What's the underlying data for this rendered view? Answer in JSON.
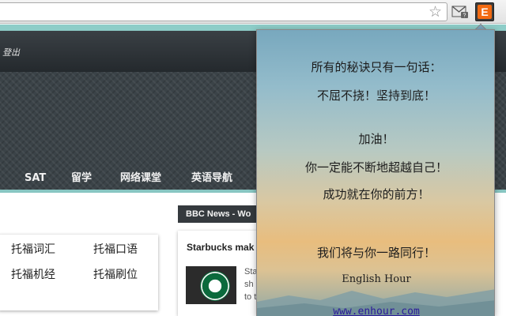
{
  "browser": {
    "bookmark_icon": "star-icon",
    "extensions": [
      "gmail-checker-icon",
      "english-hour-extension-icon"
    ],
    "ext_e_label": "E"
  },
  "header": {
    "logout_label": "登出",
    "nav": [
      "SAT",
      "留学",
      "网络课堂",
      "英语导航"
    ]
  },
  "content": {
    "news_tab_label": "BBC News - Wo",
    "toefl_links": [
      "托福词汇",
      "托福口语",
      "托福机经",
      "托福刷位"
    ],
    "news_title": "Starbucks mak",
    "news_snippet": [
      "Sta",
      "sh",
      "to t"
    ]
  },
  "popup": {
    "line1": "所有的秘诀只有一句话：",
    "line2": "不屈不挠！坚持到底！",
    "line3": "加油！",
    "line4": "你一定能不断地超越自己！",
    "line5": "成功就在你的前方！",
    "line6": "我们将与你一路同行！",
    "brand": "English Hour",
    "link": "www.enhour.com"
  },
  "colors": {
    "ext_accent": "#f26a12",
    "header_dark": "#2c3236",
    "teal": "#8ecdc8"
  }
}
